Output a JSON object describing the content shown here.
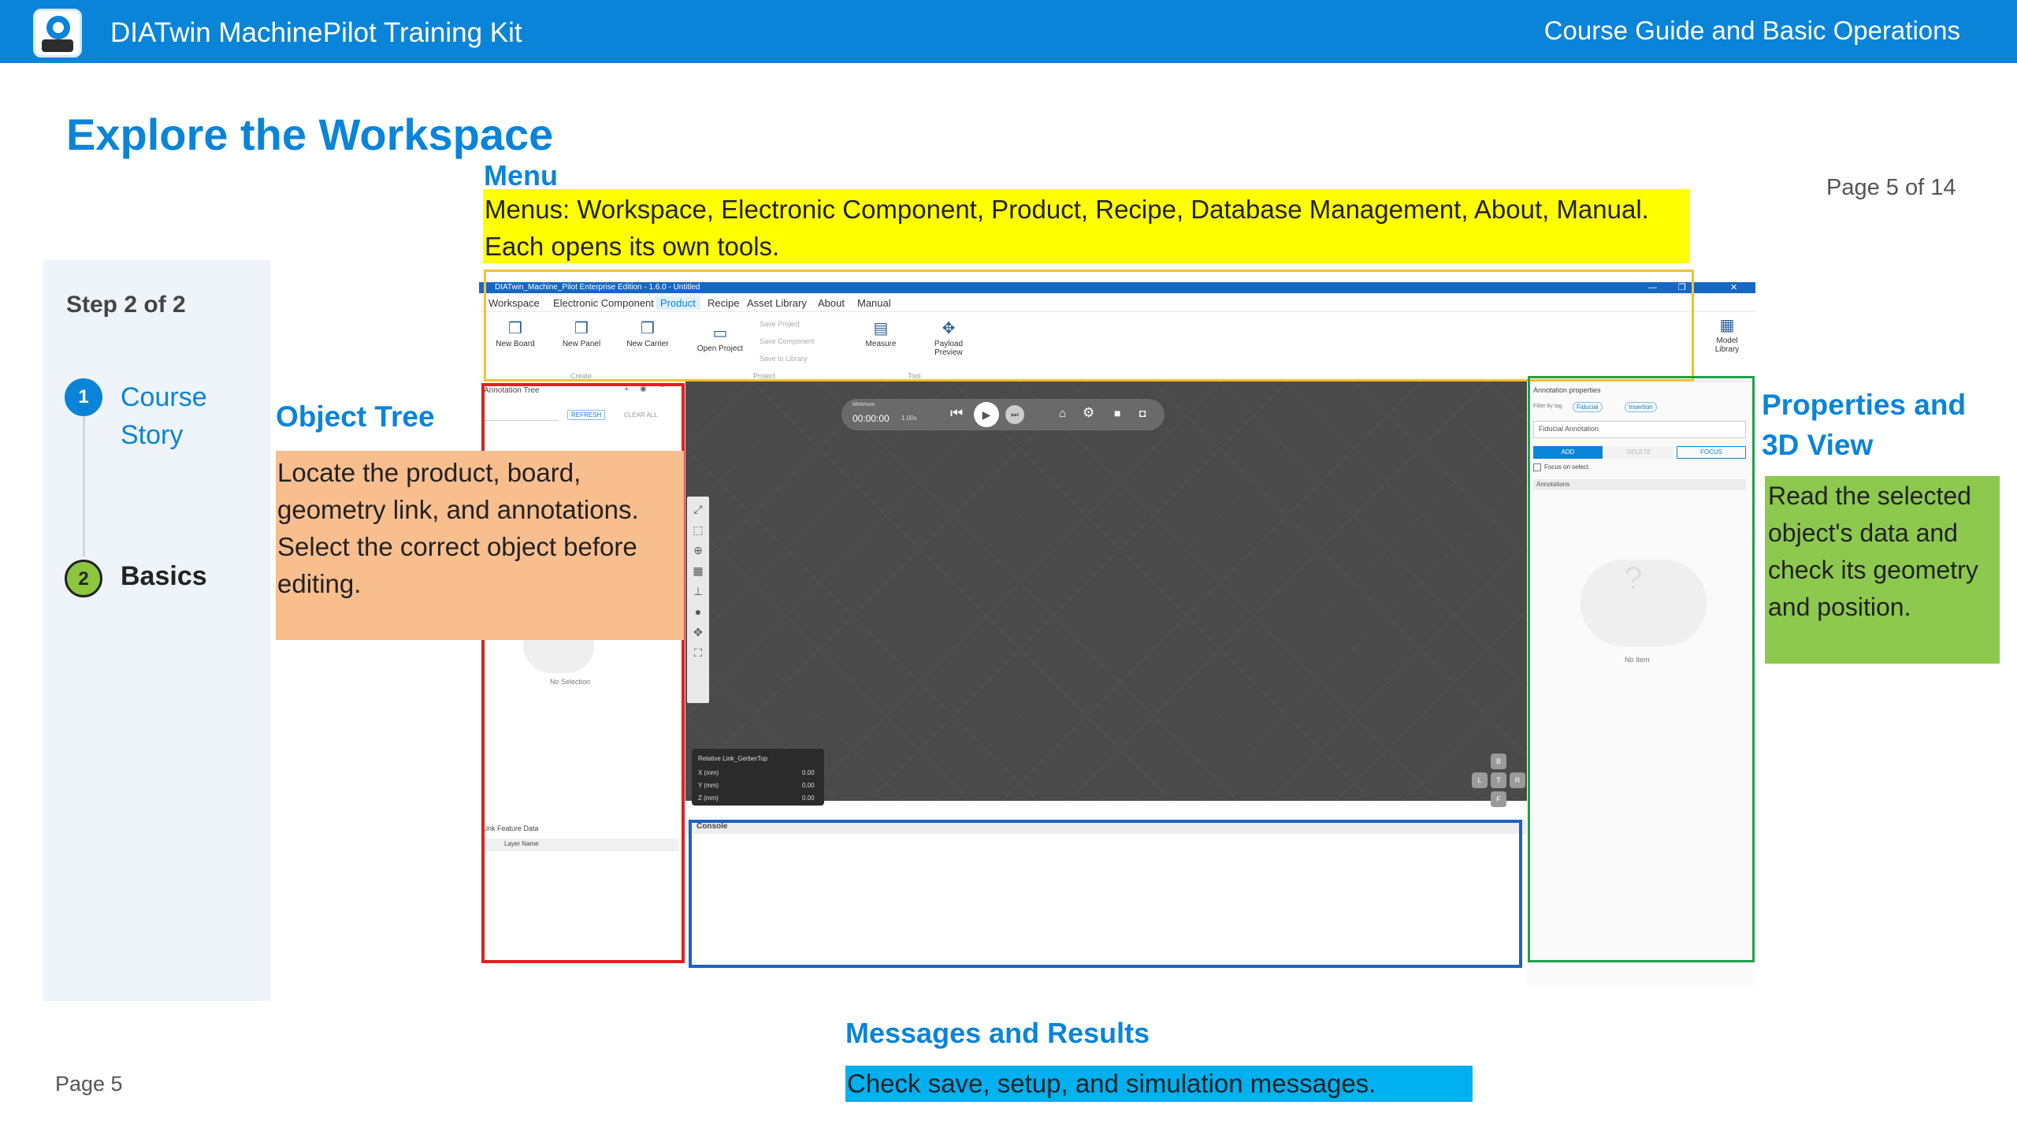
{
  "header": {
    "app_title": "DIATwin MachinePilot Training Kit",
    "guide_title": "Course Guide and Basic Operations"
  },
  "page": {
    "heading": "Explore the Workspace",
    "page_of": "Page 5 of 14",
    "footer_page": "Page 5"
  },
  "steps": {
    "label": "Step 2 of 2",
    "items": [
      {
        "number": "1",
        "label": "Course Story"
      },
      {
        "number": "2",
        "label": "Basics"
      }
    ]
  },
  "callouts": {
    "menu": {
      "title": "Menu",
      "text": "Menus: Workspace, Electronic Component, Product, Recipe, Database Management, About, Manual. Each opens its own tools."
    },
    "object_tree": {
      "title": "Object Tree",
      "text": "Locate the product, board, geometry link, and annotations. Select the correct object before editing."
    },
    "properties": {
      "title": "Properties and 3D View",
      "text": "Read the selected object's data and check its geometry and position."
    },
    "messages": {
      "title": "Messages and Results",
      "text": "Check save, setup, and simulation messages."
    }
  },
  "colors": {
    "menu_box": "#f5c030",
    "object_tree_box": "#e02020",
    "properties_box": "#1fa04a",
    "messages_box": "#1a63c4"
  },
  "app": {
    "window_title": "DIATwin_Machine_Pilot Enterprise Edition - 1.6.0 - Untitled",
    "menu": [
      "Workspace",
      "Electronic Component",
      "Product",
      "Recipe",
      "Asset Library",
      "About",
      "Manual"
    ],
    "active_menu": "Product",
    "ribbon": {
      "create": {
        "label": "Create",
        "buttons": [
          "New Board",
          "New Panel",
          "New Carrier"
        ]
      },
      "project": {
        "label": "Project",
        "open": "Open Project",
        "small": [
          "Save Project",
          "Save Component",
          "Save to Library"
        ]
      },
      "tool": {
        "label": "Tool",
        "buttons": [
          "Measure",
          "Payload Preview"
        ]
      },
      "model_library": "Model Library"
    },
    "annotation_tree": {
      "title": "Annotation Tree",
      "refresh": "REFRESH",
      "clear_all": "CLEAR ALL",
      "empty": "No Selection"
    },
    "link_feature": {
      "title": "Link Feature Data",
      "column": "Layer Name"
    },
    "playbar": {
      "mode": "Minimum",
      "time": "00:00:00",
      "speed": "1.00x"
    },
    "coord": {
      "title": "Relative Link_GerberTop",
      "rows": [
        {
          "label": "X (mm)",
          "value": "0.00"
        },
        {
          "label": "Y (mm)",
          "value": "0.00"
        },
        {
          "label": "Z (mm)",
          "value": "0.00"
        }
      ]
    },
    "navcube": [
      "B",
      "L",
      "T",
      "R",
      "F"
    ],
    "console": {
      "title": "Console"
    },
    "properties": {
      "title": "Annotation properties",
      "filter_label": "Filter by tag",
      "tags": [
        "Fiducial",
        "Insertion"
      ],
      "select_value": "Fiducial Annotation",
      "buttons": [
        "ADD",
        "DELETE",
        "FOCUS"
      ],
      "focus_checkbox": "Focus on select",
      "annotations_label": "Annotations",
      "empty": "No Item"
    }
  }
}
